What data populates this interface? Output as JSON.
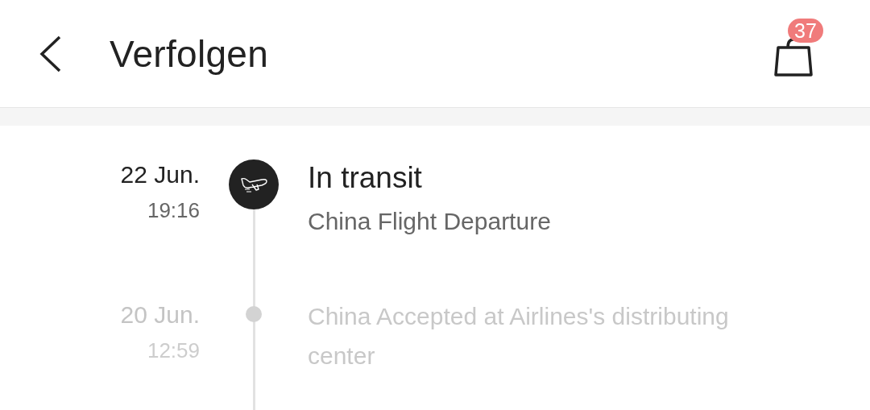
{
  "header": {
    "title": "Verfolgen",
    "cart_count": "37"
  },
  "events": [
    {
      "date": "22 Jun.",
      "time": "19:16",
      "title": "In transit",
      "description": "China Flight Departure",
      "current": true
    },
    {
      "date": "20 Jun.",
      "time": "12:59",
      "description": "China Accepted at Airlines's distributing center",
      "current": false
    }
  ]
}
